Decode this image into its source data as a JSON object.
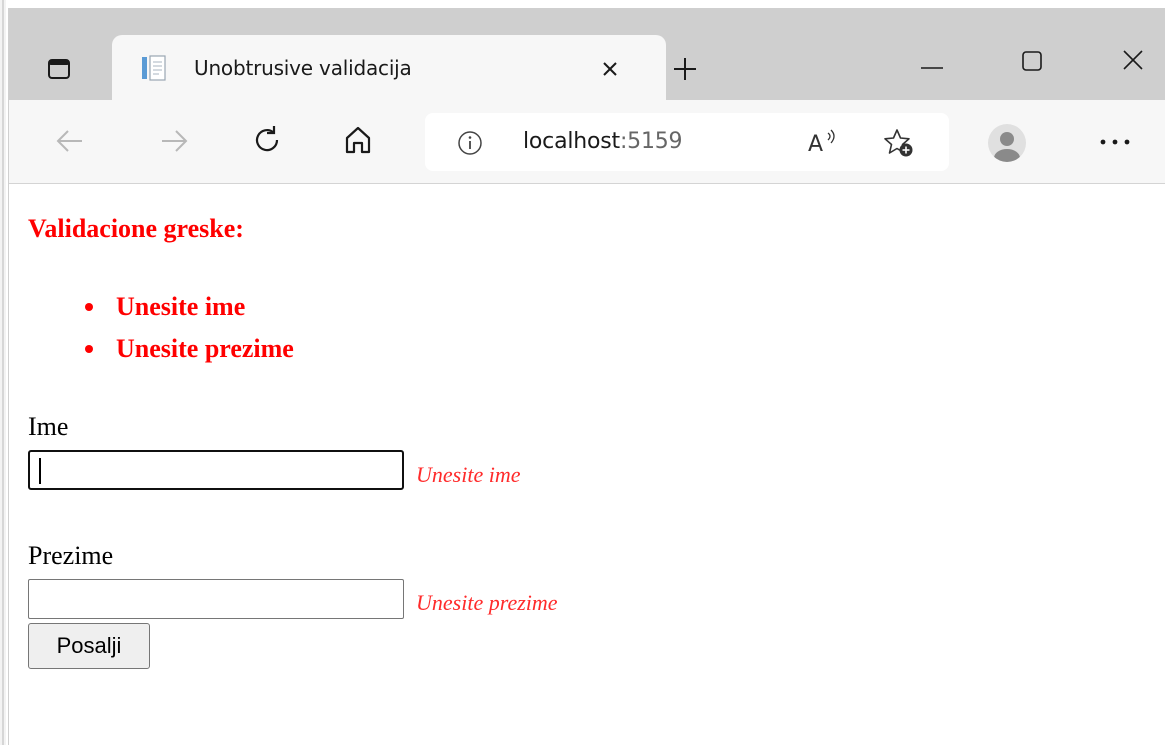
{
  "browser": {
    "tab": {
      "title": "Unobtrusive validacija",
      "favicon": "page-icon"
    },
    "address": {
      "host": "localhost",
      "port": ":5159"
    },
    "icons": {
      "tab_actions": "tab-actions-icon",
      "close_tab": "close-icon",
      "new_tab": "plus-icon",
      "minimize": "minimize-icon",
      "maximize": "maximize-icon",
      "close_window": "close-icon",
      "back": "arrow-left-icon",
      "forward": "arrow-right-icon",
      "refresh": "refresh-icon",
      "home": "home-icon",
      "site_info": "info-icon",
      "read_aloud": "read-aloud-icon",
      "add_favorite": "add-favorite-icon",
      "profile": "profile-icon",
      "menu": "more-icon"
    }
  },
  "page": {
    "summary": {
      "title": "Validacione greske:",
      "items": [
        "Unesite ime",
        "Unesite prezime"
      ]
    },
    "form": {
      "first_name": {
        "label": "Ime",
        "value": "",
        "error": "Unesite ime"
      },
      "last_name": {
        "label": "Prezime",
        "value": "",
        "error": "Unesite prezime"
      },
      "submit_label": "Posalji"
    }
  },
  "colors": {
    "error": "#ff0000",
    "tabstrip": "#cfcfcf",
    "toolbar": "#f7f7f7"
  }
}
